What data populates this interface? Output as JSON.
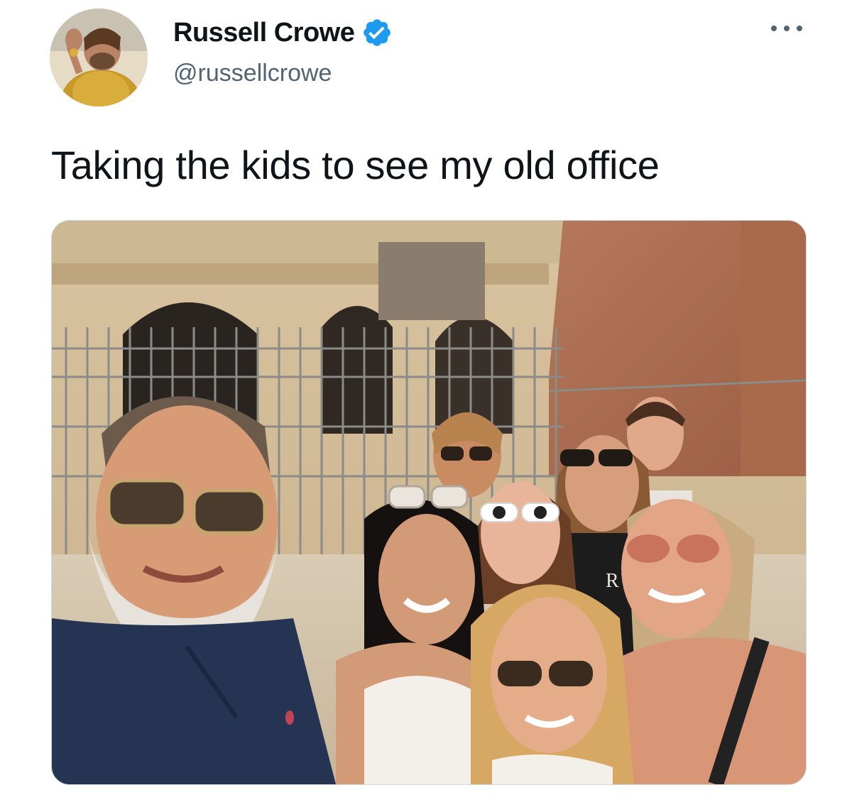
{
  "tweet": {
    "author_name": "Russell Crowe",
    "handle": "@russellcrowe",
    "verified": true,
    "text": "Taking the kids to see my old office",
    "more_icon": "more-horizontal-icon"
  },
  "media": {
    "type": "photo",
    "shirt_text": "R"
  },
  "colors": {
    "verified_blue": "#1d9bf0",
    "text_primary": "#0f1419",
    "text_secondary": "#536471"
  }
}
